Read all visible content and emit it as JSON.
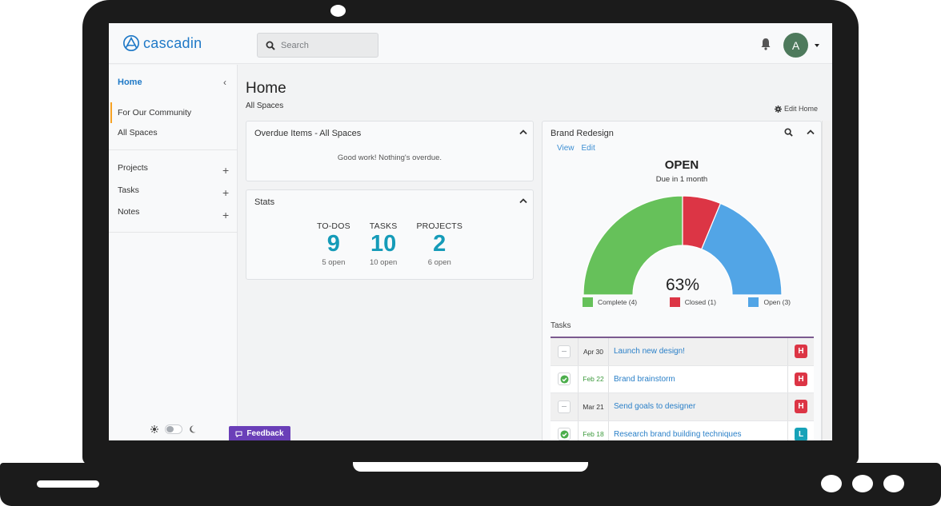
{
  "app": {
    "name": "cascadin"
  },
  "topbar": {
    "search_placeholder": "Search",
    "avatar_initial": "A"
  },
  "sidebar": {
    "home_label": "Home",
    "spaces": [
      {
        "label": "For Our Community",
        "active": true
      },
      {
        "label": "All Spaces",
        "active": false
      }
    ],
    "sections": [
      {
        "label": "Projects"
      },
      {
        "label": "Tasks"
      },
      {
        "label": "Notes"
      }
    ],
    "feedback_label": "Feedback"
  },
  "page": {
    "title": "Home",
    "subtitle": "All Spaces",
    "edit_home_label": "Edit Home"
  },
  "overdue_card": {
    "title": "Overdue Items - All Spaces",
    "message": "Good work! Nothing's overdue."
  },
  "stats_card": {
    "title": "Stats",
    "stats": [
      {
        "label": "TO-DOS",
        "value": "9",
        "sub": "5 open"
      },
      {
        "label": "TASKS",
        "value": "10",
        "sub": "10 open"
      },
      {
        "label": "PROJECTS",
        "value": "2",
        "sub": "6 open"
      }
    ]
  },
  "project_card": {
    "title": "Brand Redesign",
    "links": [
      "View",
      "Edit"
    ],
    "status": "OPEN",
    "due": "Due in 1 month",
    "percent_label": "63%",
    "gauge": [
      {
        "label": "Complete (4)",
        "value": 4,
        "color": "#66c15a"
      },
      {
        "label": "Closed (1)",
        "value": 1,
        "color": "#dc3545"
      },
      {
        "label": "Open (3)",
        "value": 3,
        "color": "#52a5e6"
      }
    ],
    "tasks_label": "Tasks",
    "tasks": [
      {
        "date": "Apr 30",
        "name": "Launch new design!",
        "done": false,
        "priority": "H",
        "priority_color": "#dc3545"
      },
      {
        "date": "Feb 22",
        "name": "Brand brainstorm",
        "done": true,
        "priority": "H",
        "priority_color": "#dc3545"
      },
      {
        "date": "Mar 21",
        "name": "Send goals to designer",
        "done": false,
        "priority": "H",
        "priority_color": "#dc3545"
      },
      {
        "date": "Feb 18",
        "name": "Research brand building techniques",
        "done": true,
        "priority": "L",
        "priority_color": "#17a2b8"
      }
    ]
  },
  "colors": {
    "brand": "#1f79c7",
    "stat_value": "#159bb8",
    "feedback": "#6a3fb8",
    "accent": "#f7a325",
    "done_date": "#3d9a3d"
  }
}
